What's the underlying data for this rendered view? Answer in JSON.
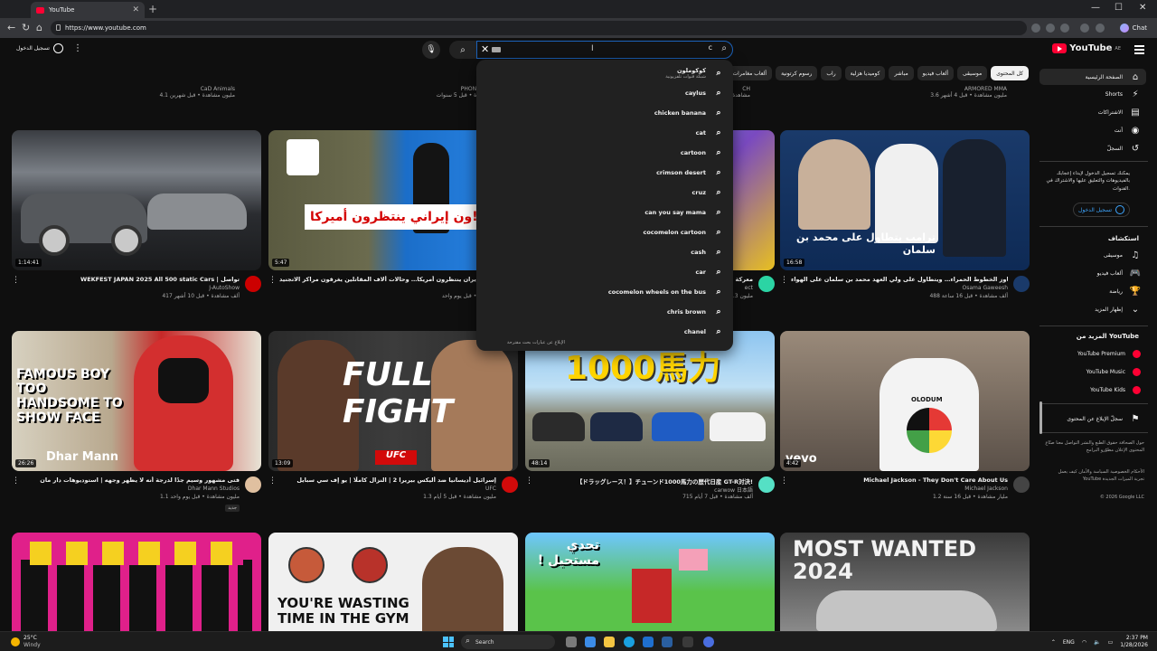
{
  "browser": {
    "tab_title": "YouTube",
    "url": "https://www.youtube.com",
    "chat_label": "Chat"
  },
  "header": {
    "logo_text": "YouTube",
    "logo_region": "AE",
    "sign_in": "تسجيل الدخول",
    "search_placeholder": "بحث",
    "search_query_glyph": "c"
  },
  "chips": [
    "كل المحتوى",
    "موسيقى",
    "ألعاب فيديو",
    "مباشر",
    "كوميديا هزلية",
    "راب",
    "رسوم كرتونية",
    "ألعاب مغامرات وحركة"
  ],
  "suggestions": [
    {
      "text": "كوكوملون",
      "sub": "شبكة قنوات تلفزيونية"
    },
    {
      "text": "caylus"
    },
    {
      "text": "chicken banana"
    },
    {
      "text": "cat"
    },
    {
      "text": "cartoon"
    },
    {
      "text": "crimson desert"
    },
    {
      "text": "cruz"
    },
    {
      "text": "can you say mama"
    },
    {
      "text": "cocomelon cartoon"
    },
    {
      "text": "cash"
    },
    {
      "text": "car"
    },
    {
      "text": "cocomelon wheels on the bus"
    },
    {
      "text": "chris brown"
    },
    {
      "text": "chanel"
    }
  ],
  "suggestions_report": "الإبلاغ عن عبارات بحث مقترحة",
  "sidebar": {
    "home": "الصفحة الرئيسية",
    "shorts": "Shorts",
    "subscriptions": "الاشتراكات",
    "you": "أنت",
    "history": "السجلّ",
    "signin_note": "يمكنك تسجيل الدخول لإبداء إعجابك بالفيديوهات والتعليق عليها والاشتراك في القنوات.",
    "signin_button": "تسجيل الدخول",
    "explore_title": "استكشاف",
    "explore": [
      "موسيقى",
      "ألعاب فيديو",
      "رياضة"
    ],
    "show_more": "إظهار المزيد",
    "more_title": "المزيد من YouTube",
    "more": [
      "YouTube Premium",
      "YouTube Music",
      "YouTube Kids"
    ],
    "report_history": "سجلّ الإبلاغ عن المحتوى",
    "footer1": "حول   الصحافة   حقوق الطبع والنشر   التواصل معنا   صنّاع المحتوى   الإعلان   مطوّرو البرامج",
    "footer2": "الأحكام   الخصوصية   السياسة والأمان   كيف يعمل YouTube   تجربة الميزات الجديدة",
    "copyright": "© 2026 Google LLC"
  },
  "top_row": [
    {
      "channel": "CaD Animals",
      "stats": "4.1 مليون مشاهدة • قبل شهرين"
    },
    {
      "channel": "PHONKONA",
      "stats": "مشاهدة • قبل 5 سنوات"
    },
    {
      "channel": "CH",
      "stats": "418 مشاهدة"
    },
    {
      "channel": "ARMORED MMA",
      "stats": "3.6 مليون مشاهدة • قبل 4 أشهر"
    }
  ],
  "videos": [
    {
      "title": "WEKFEST JAPAN 2025 All 500 static Cars | تواصل",
      "channel": "J-AutoShow",
      "stats": "417 ألف مشاهدة • قبل 10 أشهر",
      "duration": "1:14:41",
      "overlay": ""
    },
    {
      "title": "ألاف الجنود في إيران ينتظرون أمريكا… وحالات ألاف المقاتلين يغرقون مراكز الاتجنيد",
      "channel": "",
      "stats": "مشاهدة • قبل يوم واحد",
      "duration": "5:47",
      "overlay": "ون إيراني ينتظرون أميركا!"
    },
    {
      "title": "معركة",
      "channel": "ect",
      "stats": "3.3 مليون",
      "duration": "",
      "overlay": ""
    },
    {
      "title": "أسامة جاويش: ترامب يتجاوز الخطوط الحمراء… ويتطاول على ولي العهد محمد بن سلمان على الهواء!",
      "channel": "Osama Gaweesh",
      "stats": "488 ألف مشاهدة • قبل 16 ساعة",
      "duration": "16:58",
      "overlay": "ترامب يتطاول على محمد بن سلمان"
    },
    {
      "title": "فتى مشهور وسيم جدًا لدرجة أنه لا يظهر وجهه | استوديوهات دار مان",
      "channel": "Dhar Mann Studios",
      "stats": "1.1 مليون مشاهدة • قبل يوم واحد",
      "duration": "26:26",
      "overlay": "FAMOUS BOY TOO HANDSOME TO SHOW FACE",
      "badge": "جديد"
    },
    {
      "title": "إسرائيل أديسانيا ضد أليكس بيريرا 2 | النزال كاملًا | يو إف سي سبايل",
      "channel": "UFC",
      "stats": "1.3 مليون مشاهدة • قبل 5 أيام",
      "duration": "13:09",
      "overlay": "FULL FIGHT"
    },
    {
      "title": "【ドラッグレース！】チューンド1000馬力の歴代日産 GT-R対決!",
      "channel": "carwow 日本語",
      "stats": "715 ألف مشاهدة • قبل 7 أيام",
      "duration": "48:14",
      "overlay": "1000馬力"
    },
    {
      "title": "Michael Jackson - They Don't Care About Us",
      "channel": "Michael Jackson",
      "stats": "1.2 مليار مشاهدة • قبل 16 سنة",
      "duration": "4:42",
      "overlay": "OLODUM"
    },
    {
      "title": "",
      "channel": "",
      "stats": "",
      "duration": "",
      "overlay": ""
    },
    {
      "title": "",
      "channel": "",
      "stats": "",
      "duration": "",
      "overlay": "YOU'RE WASTING TIME IN THE GYM"
    },
    {
      "title": "",
      "channel": "",
      "stats": "",
      "duration": "",
      "overlay": "تحدي مستحيل !"
    },
    {
      "title": "",
      "channel": "",
      "stats": "",
      "duration": "",
      "overlay": "MOST WANTED 2024"
    }
  ],
  "taskbar": {
    "temp": "25°C",
    "weather": "Windy",
    "search": "Search",
    "lang": "ENG",
    "time": "2:37 PM",
    "date": "1/28/2026"
  }
}
